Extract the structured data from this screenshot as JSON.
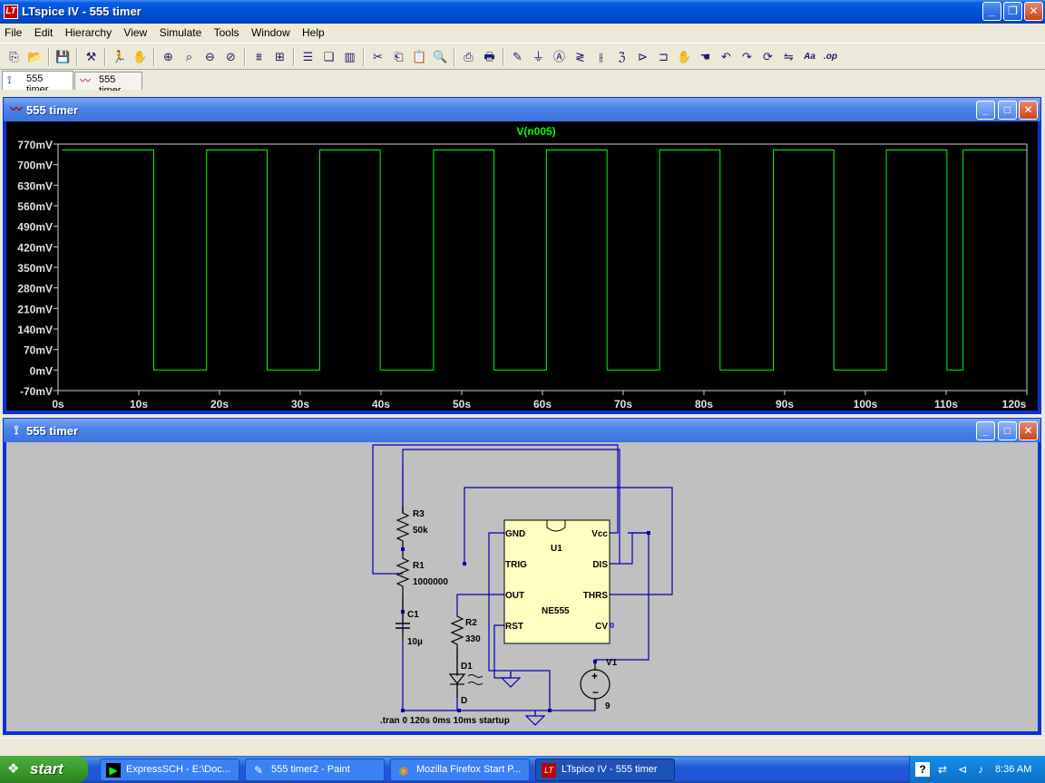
{
  "window": {
    "title": "LTspice IV - 555 timer"
  },
  "menu": [
    "File",
    "Edit",
    "Hierarchy",
    "View",
    "Simulate",
    "Tools",
    "Window",
    "Help"
  ],
  "toolbar_icons": [
    "open-schematic-icon",
    "open-file-icon",
    "|",
    "save-icon",
    "|",
    "control-panel-icon",
    "|",
    "run-icon",
    "halt-icon",
    "|",
    "zoom-in-icon",
    "zoom-area-icon",
    "zoom-out-icon",
    "zoom-cancel-icon",
    "|",
    "autorange-icon",
    "unmark-icon",
    "|",
    "tile-horizontal-icon",
    "cascade-icon",
    "tile-vertical-icon",
    "|",
    "cut-icon",
    "copy-icon",
    "paste-icon",
    "find-icon",
    "|",
    "print-setup-icon",
    "print-icon",
    "|",
    "wire-icon",
    "ground-icon",
    "label-icon",
    "resistor-icon",
    "capacitor-icon",
    "inductor-icon",
    "diode-icon",
    "component-icon",
    "move-icon",
    "drag-icon",
    "undo-icon",
    "redo-icon",
    "rotate-icon",
    "mirror-icon",
    "text-icon",
    "spice-directive-icon"
  ],
  "tabs": [
    {
      "label": "555 timer",
      "icon": "schematic-icon",
      "active": true
    },
    {
      "label": "555 timer",
      "icon": "waveform-icon",
      "active": false
    }
  ],
  "plot_window": {
    "title": "555 timer",
    "trace_label": "V(n005)",
    "trace_color": "#00ff00",
    "chart_data": {
      "type": "line",
      "series": [
        {
          "name": "V(n005)",
          "transitions_s": [
            0.5,
            11.85,
            18.4,
            25.9,
            32.4,
            39.9,
            46.5,
            54.0,
            60.5,
            68.0,
            74.5,
            82.0,
            88.6,
            96.1,
            102.6,
            110.1,
            112.1,
            120
          ],
          "high_mV": 750,
          "low_mV": 0
        }
      ],
      "xlim": [
        0,
        120
      ],
      "ylim": [
        -70,
        770
      ],
      "x_ticks": [
        "0s",
        "10s",
        "20s",
        "30s",
        "40s",
        "50s",
        "60s",
        "70s",
        "80s",
        "90s",
        "100s",
        "110s",
        "120s"
      ],
      "y_ticks": [
        "770mV",
        "700mV",
        "630mV",
        "560mV",
        "490mV",
        "420mV",
        "350mV",
        "280mV",
        "210mV",
        "140mV",
        "70mV",
        "0mV",
        "-70mV"
      ]
    }
  },
  "schematic_window": {
    "title": "555 timer",
    "components": {
      "R3": {
        "name": "R3",
        "value": "50k"
      },
      "R1": {
        "name": "R1",
        "value": "1000000"
      },
      "C1": {
        "name": "C1",
        "value": "10µ"
      },
      "R2": {
        "name": "R2",
        "value": "330"
      },
      "D1": {
        "name": "D1",
        "value": "D"
      },
      "V1": {
        "name": "V1",
        "value": "9"
      },
      "U1": {
        "name": "U1",
        "model": "NE555",
        "pins": {
          "gnd": "GND",
          "trig": "TRIG",
          "out": "OUT",
          "rst": "RST",
          "vcc": "Vcc",
          "dis": "DIS",
          "thrs": "THRS",
          "cv": "CV"
        }
      }
    },
    "directive": ".tran 0 120s 0ms 10ms startup"
  },
  "taskbar": {
    "start_label": "start",
    "buttons": [
      {
        "label": "ExpressSCH - E:\\Doc...",
        "icon": "expresssch-icon",
        "active": false
      },
      {
        "label": "555 timer2 - Paint",
        "icon": "paint-icon",
        "active": false
      },
      {
        "label": "Mozilla Firefox Start P...",
        "icon": "firefox-icon",
        "active": false
      },
      {
        "label": "LTspice IV - 555 timer",
        "icon": "ltspice-icon",
        "active": true
      }
    ],
    "clock": "8:36 AM"
  }
}
